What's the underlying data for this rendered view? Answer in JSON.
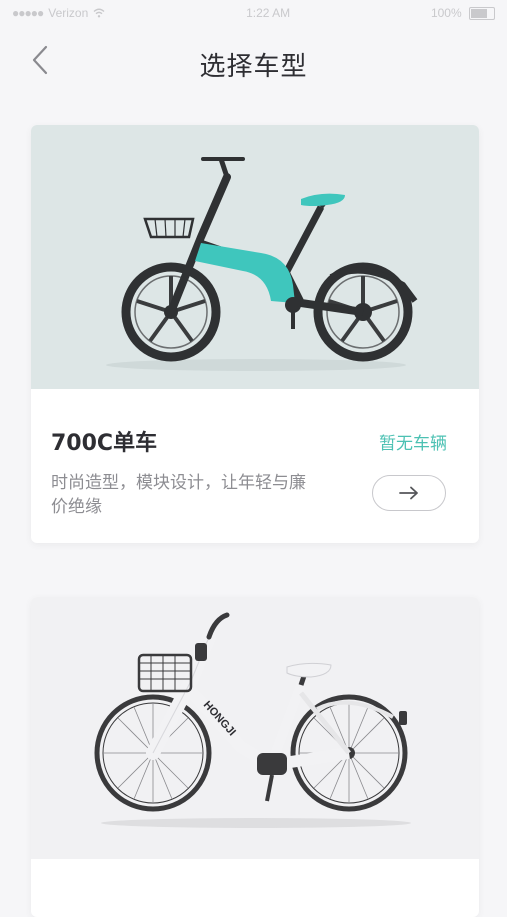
{
  "status_bar": {
    "carrier": "Verizon",
    "time": "1:22 AM",
    "battery": "100%"
  },
  "header": {
    "title": "选择车型"
  },
  "cards": [
    {
      "name": "700C单车",
      "availability": "暂无车辆",
      "description": "时尚造型，模块设计，让年轻与廉价绝缘",
      "accent_color": "#3fc6bd"
    },
    {
      "brand_text": "HONGJI"
    }
  ],
  "colors": {
    "accent": "#4cc1b3",
    "background": "#f6f6f8"
  },
  "icons": {
    "back": "chevron-left-icon",
    "go": "arrow-right-icon"
  }
}
